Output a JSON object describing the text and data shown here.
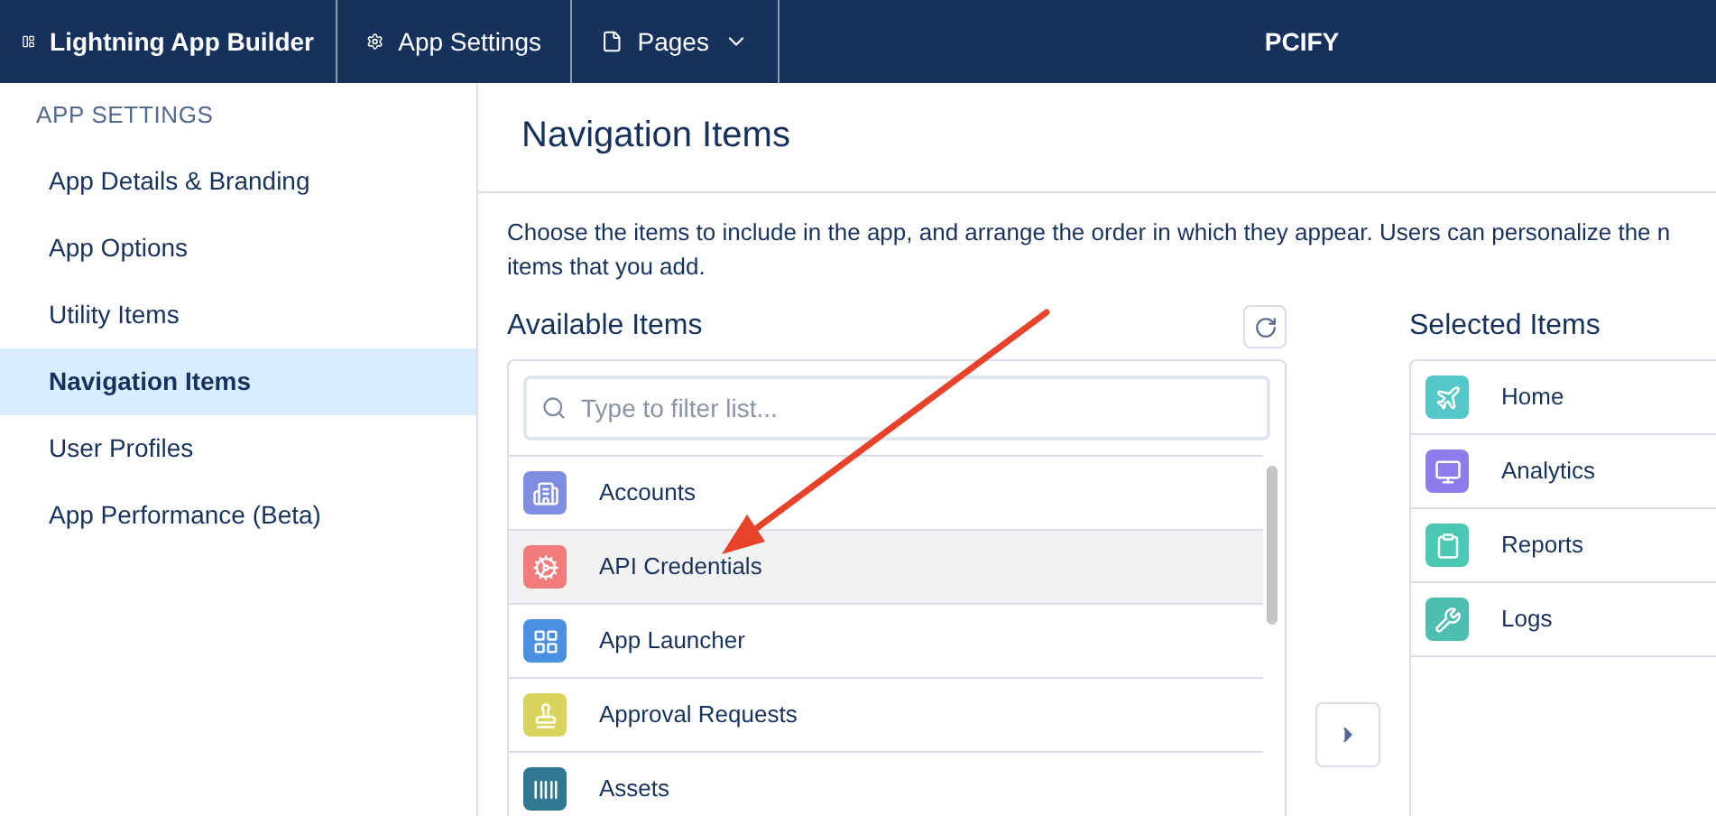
{
  "top_bar": {
    "app_name": "Lightning App Builder",
    "tabs": [
      {
        "label": "App Settings",
        "kind": "settings"
      },
      {
        "label": "Pages",
        "kind": "pages"
      }
    ],
    "org_name": "PCIFY"
  },
  "sidebar": {
    "heading": "APP SETTINGS",
    "items": [
      {
        "label": "App Details & Branding",
        "selected": false
      },
      {
        "label": "App Options",
        "selected": false
      },
      {
        "label": "Utility Items",
        "selected": false
      },
      {
        "label": "Navigation Items",
        "selected": true
      },
      {
        "label": "User Profiles",
        "selected": false
      },
      {
        "label": "App Performance (Beta)",
        "selected": false
      }
    ]
  },
  "main": {
    "title": "Navigation Items",
    "description": "Choose the items to include in the app, and arrange the order in which they appear. Users can personalize the n\nitems that you add.",
    "available": {
      "heading": "Available Items",
      "filter_placeholder": "Type to filter list...",
      "items": [
        {
          "label": "Accounts",
          "kind": "building",
          "color": "#7f8de1",
          "selected": false
        },
        {
          "label": "API Credentials",
          "kind": "gears",
          "color": "#f27b7b",
          "selected": true
        },
        {
          "label": "App Launcher",
          "kind": "grid",
          "color": "#4a90e2",
          "selected": false
        },
        {
          "label": "Approval Requests",
          "kind": "stamp",
          "color": "#d9d55c",
          "selected": false
        },
        {
          "label": "Assets",
          "kind": "barcode",
          "color": "#317992",
          "selected": false
        }
      ]
    },
    "selected": {
      "heading": "Selected Items",
      "items": [
        {
          "label": "Home",
          "kind": "plane",
          "color": "#54c7c9"
        },
        {
          "label": "Analytics",
          "kind": "monitor",
          "color": "#8f7cec"
        },
        {
          "label": "Reports",
          "kind": "clipboard",
          "color": "#4bc8b3"
        },
        {
          "label": "Logs",
          "kind": "wrench",
          "color": "#4dbfb0"
        }
      ]
    }
  }
}
